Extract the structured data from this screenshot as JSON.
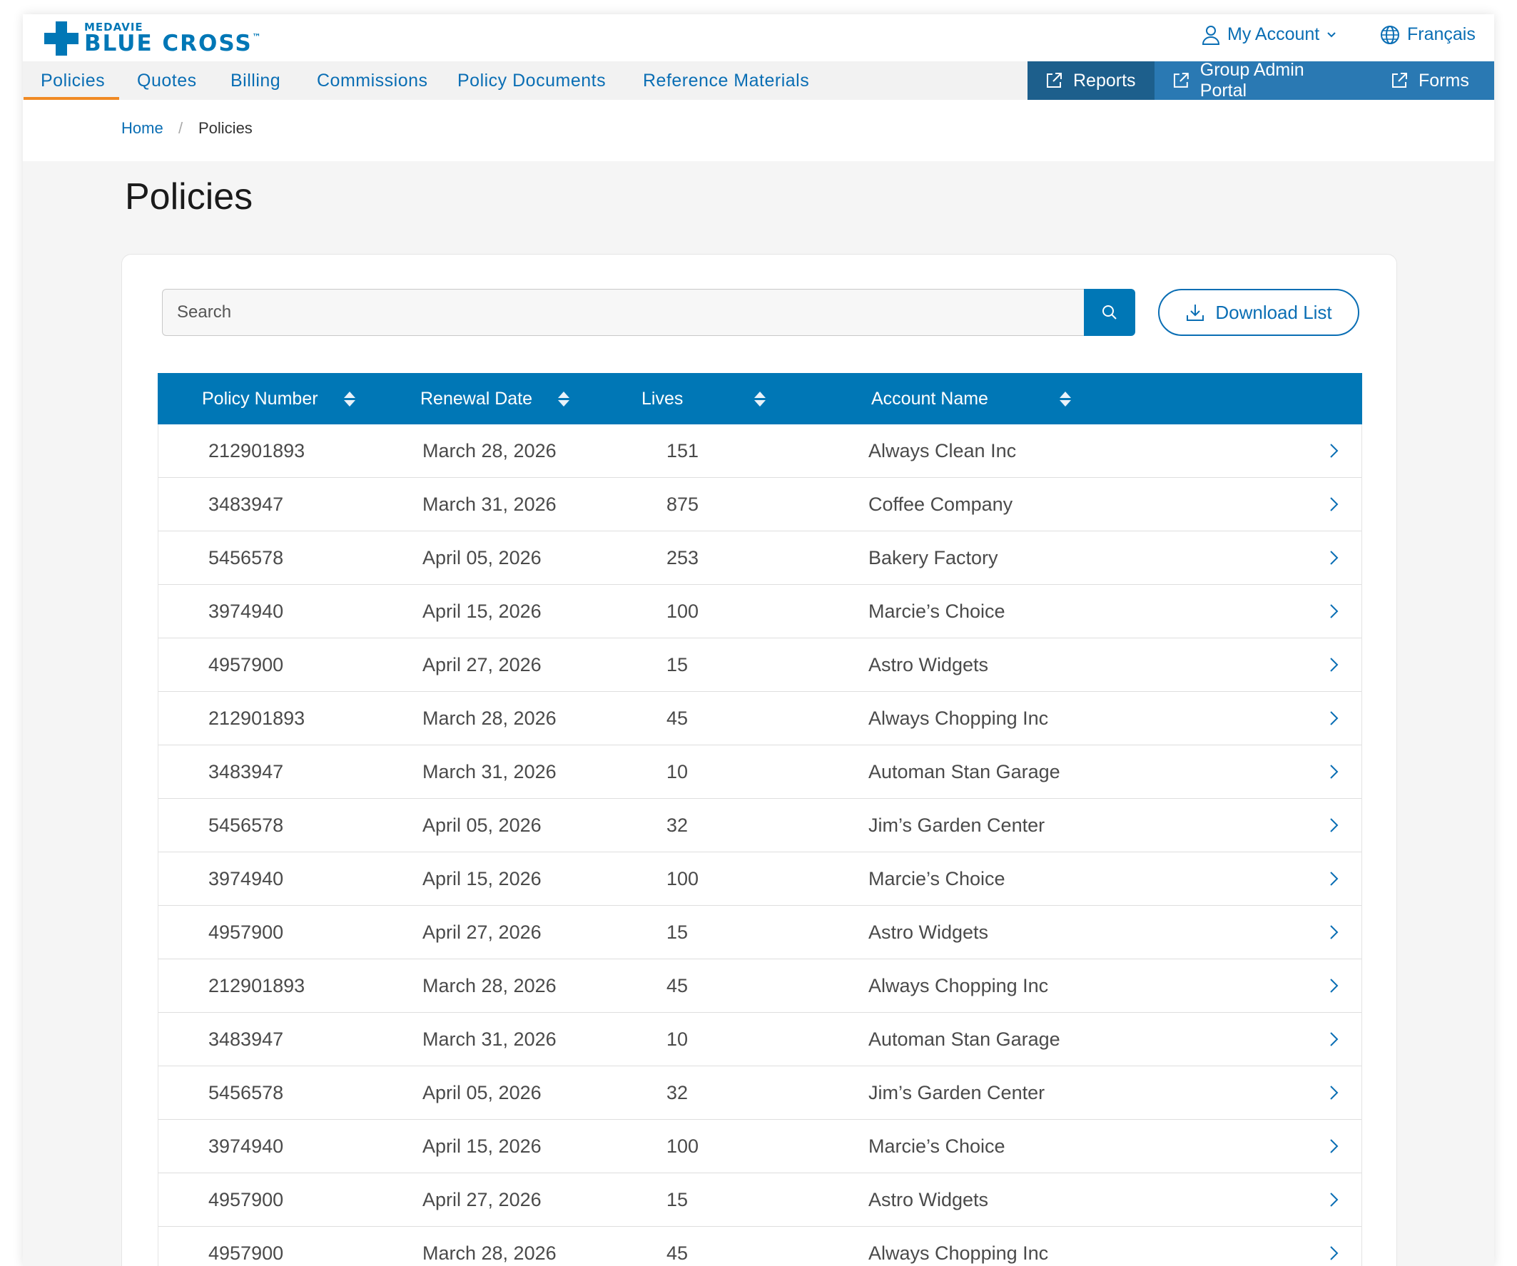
{
  "brand": {
    "small": "MEDAVIE",
    "big": "BLUE CROSS",
    "tm": "™"
  },
  "utility": {
    "account_label": "My Account",
    "language_label": "Français"
  },
  "nav": {
    "items": [
      "Policies",
      "Quotes",
      "Billing",
      "Commissions",
      "Policy Documents",
      "Reference Materials"
    ],
    "active": "Policies",
    "external": [
      "Reports",
      "Group Admin Portal",
      "Forms"
    ]
  },
  "breadcrumb": {
    "home": "Home",
    "separator": "/",
    "current": "Policies"
  },
  "page": {
    "title": "Policies"
  },
  "search": {
    "placeholder": "Search",
    "value": ""
  },
  "download_label": "Download List",
  "table": {
    "columns": [
      "Policy Number",
      "Renewal Date",
      "Lives",
      "Account Name"
    ],
    "rows": [
      [
        "212901893",
        "March 28, 2026",
        "151",
        "Always Clean Inc"
      ],
      [
        "3483947",
        "March 31, 2026",
        "875",
        "Coffee Company"
      ],
      [
        "5456578",
        "April 05, 2026",
        "253",
        "Bakery Factory"
      ],
      [
        "3974940",
        "April 15, 2026",
        "100",
        "Marcie’s Choice"
      ],
      [
        "4957900",
        "April 27, 2026",
        "15",
        "Astro Widgets"
      ],
      [
        "212901893",
        "March 28, 2026",
        "45",
        "Always Chopping Inc"
      ],
      [
        "3483947",
        "March 31, 2026",
        "10",
        "Automan Stan Garage"
      ],
      [
        "5456578",
        "April 05, 2026",
        "32",
        "Jim’s Garden Center"
      ],
      [
        "3974940",
        "April 15, 2026",
        "100",
        "Marcie’s Choice"
      ],
      [
        "4957900",
        "April 27, 2026",
        "15",
        "Astro Widgets"
      ],
      [
        "212901893",
        "March 28, 2026",
        "45",
        "Always Chopping Inc"
      ],
      [
        "3483947",
        "March 31, 2026",
        "10",
        "Automan Stan Garage"
      ],
      [
        "5456578",
        "April 05, 2026",
        "32",
        "Jim’s Garden Center"
      ],
      [
        "3974940",
        "April 15, 2026",
        "100",
        "Marcie’s Choice"
      ],
      [
        "4957900",
        "April 27, 2026",
        "15",
        "Astro Widgets"
      ],
      [
        "4957900",
        "March 28, 2026",
        "45",
        "Always Chopping Inc"
      ]
    ]
  },
  "colors": {
    "primary": "#0077b6",
    "nav_button_dark": "#1d5f8c",
    "nav_button": "#2a79b3",
    "active_underline": "#f08a24"
  }
}
